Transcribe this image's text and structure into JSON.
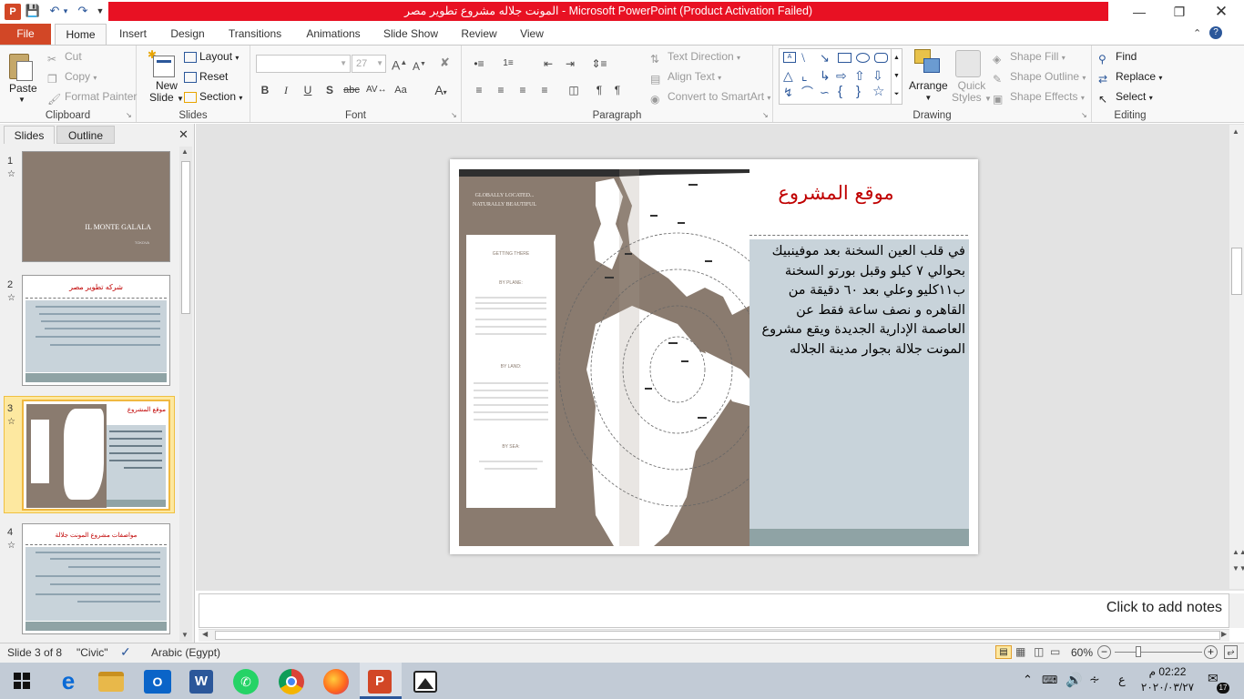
{
  "window": {
    "title": "المونت جلاله مشروع تطوير مصر  -  Microsoft PowerPoint (Product Activation Failed)"
  },
  "tabs": [
    "File",
    "Home",
    "Insert",
    "Design",
    "Transitions",
    "Animations",
    "Slide Show",
    "Review",
    "View"
  ],
  "ribbon": {
    "clipboard": {
      "paste": "Paste",
      "cut": "Cut",
      "copy": "Copy",
      "format_painter": "Format Painter",
      "label": "Clipboard"
    },
    "slides": {
      "new_slide_1": "New",
      "new_slide_2": "Slide",
      "layout": "Layout",
      "reset": "Reset",
      "section": "Section",
      "label": "Slides"
    },
    "font": {
      "size": "27",
      "label": "Font"
    },
    "paragraph": {
      "text_direction": "Text Direction",
      "align_text": "Align Text",
      "convert_smartart": "Convert to SmartArt",
      "label": "Paragraph"
    },
    "drawing": {
      "arrange": "Arrange",
      "quick_styles_1": "Quick",
      "quick_styles_2": "Styles",
      "shape_fill": "Shape Fill",
      "shape_outline": "Shape Outline",
      "shape_effects": "Shape Effects",
      "label": "Drawing"
    },
    "editing": {
      "find": "Find",
      "replace": "Replace",
      "select": "Select",
      "label": "Editing"
    }
  },
  "pane": {
    "slides_tab": "Slides",
    "outline_tab": "Outline",
    "thumbnails": [
      {
        "num": "1",
        "title": "IL MONTE GALALA",
        "subtitle": "TOKDVA"
      },
      {
        "num": "2",
        "title": "شركه تطوير مصر"
      },
      {
        "num": "3",
        "title": "موقع المشروع"
      },
      {
        "num": "4",
        "title": "مواصفات مشروع المونت جلالة"
      }
    ]
  },
  "slide": {
    "title": "موقع المشروع",
    "body": "في قلب العين السخنة بعد موفينبيك بحوالي ٧ كيلو  وقبل بورتو السخنة ب١١كليو وعلي بعد ٦٠ دقيقة من القاهره و  نصف ساعة فقط عن العاصمة الإدارية الجديدة ويقع مشروع المونت جلالة بجوار مدينة الجلاله",
    "map_panel": {
      "heading_1": "GLOBALLY LOCATED...",
      "heading_2": "NATURALLY BEAUTIFUL",
      "getting_there": "GETTING THERE",
      "by_plane": "BY PLANE:",
      "by_land": "BY LAND:",
      "by_sea": "BY SEA:"
    }
  },
  "notes": {
    "placeholder": "Click to add notes"
  },
  "status": {
    "slide_info": "Slide 3 of 8",
    "theme": "\"Civic\"",
    "language": "Arabic (Egypt)",
    "zoom": "60%"
  },
  "taskbar": {
    "time": "02:22 م",
    "date": "٢٠٢٠/٠٣/٢٧",
    "lang": "ع",
    "notif_count": "17"
  },
  "colors": {
    "title_bar_red": "#e81123",
    "file_tab": "#d24726",
    "slide_title_red": "#c00000",
    "map_brown": "#8a7b6f",
    "text_panel": "#c8d3da"
  }
}
